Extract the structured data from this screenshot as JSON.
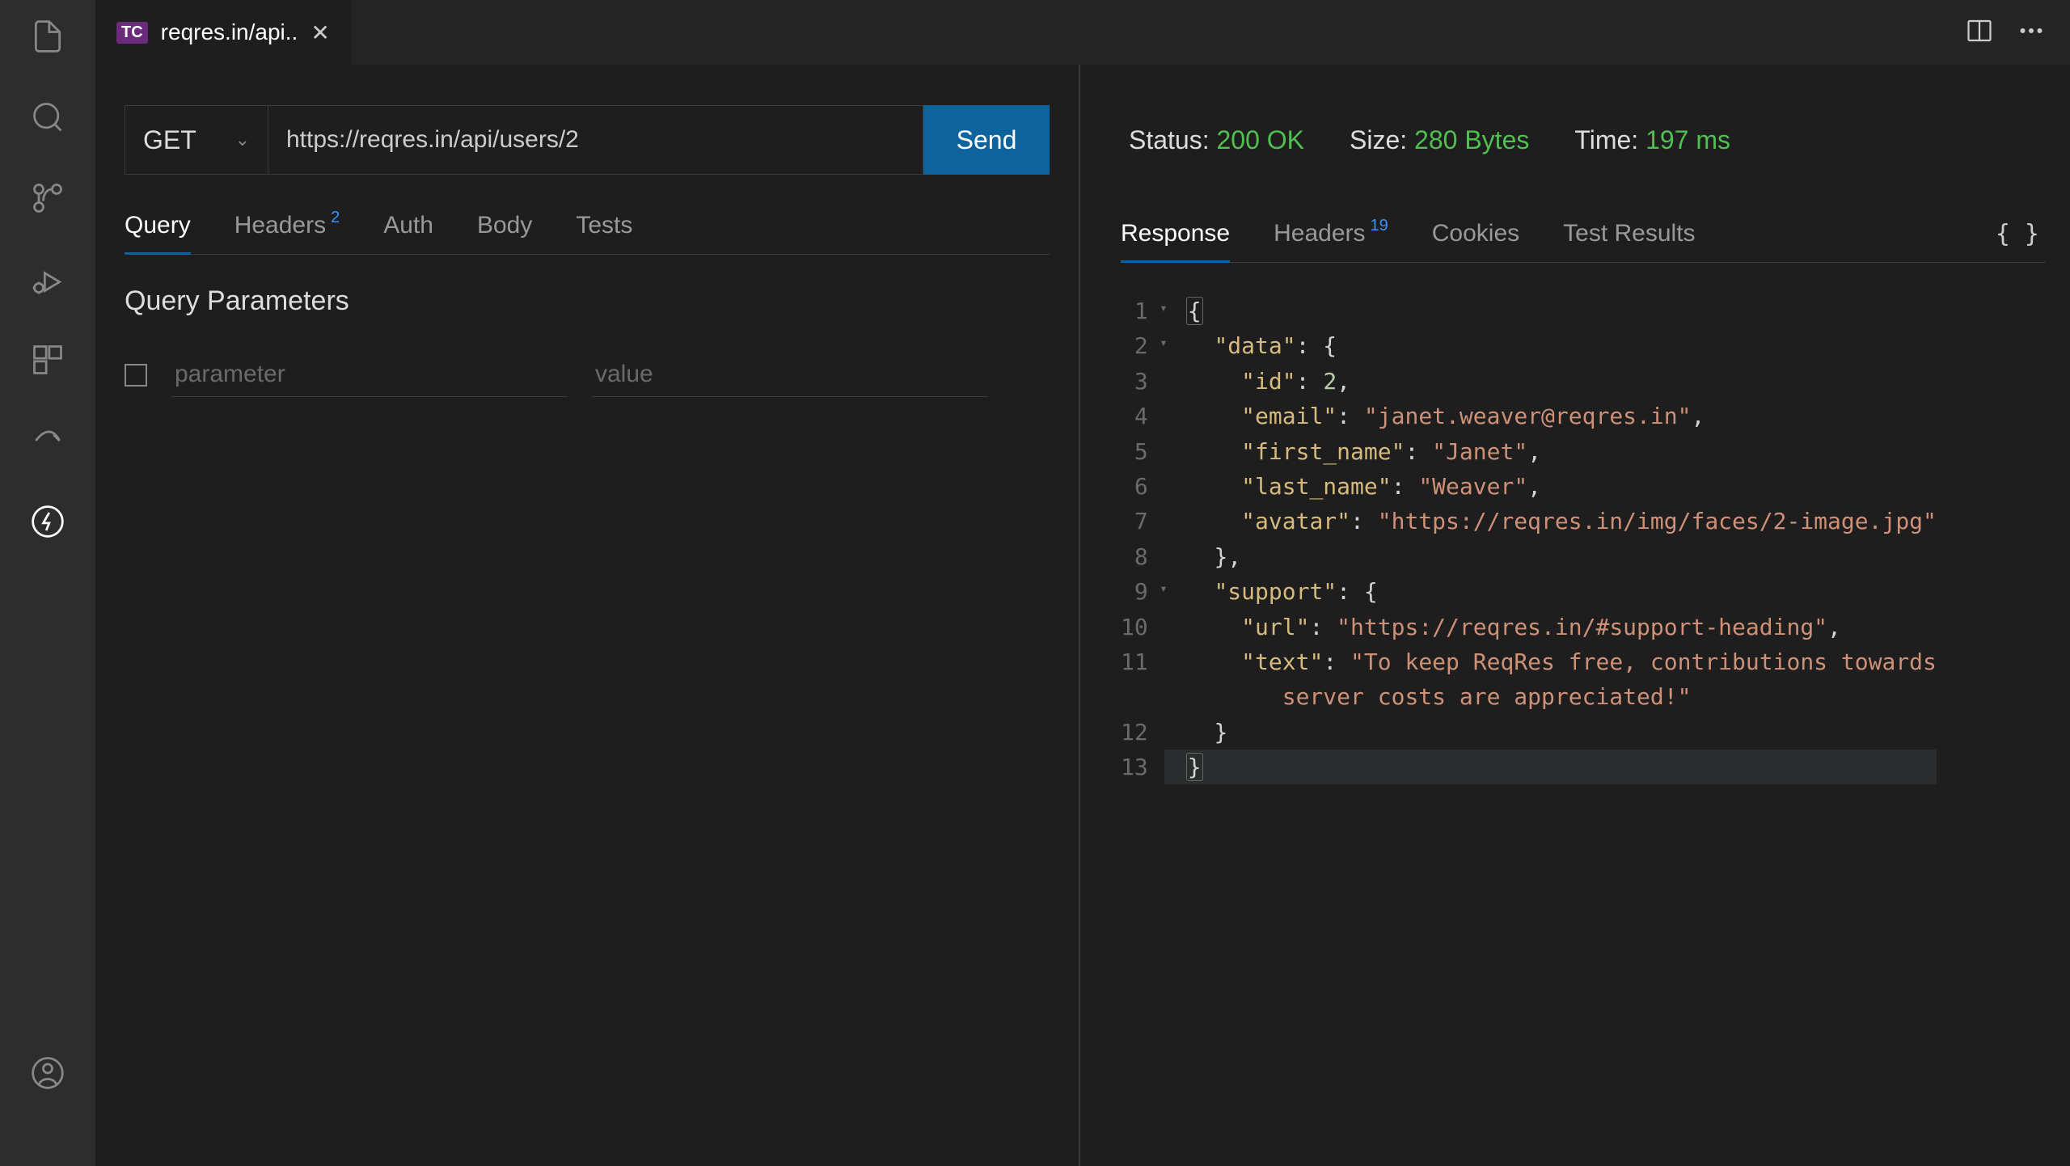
{
  "tab": {
    "badge": "TC",
    "title": "reqres.in/api.."
  },
  "request": {
    "method": "GET",
    "url": "https://reqres.in/api/users/2",
    "send_label": "Send"
  },
  "req_tabs": {
    "query": "Query",
    "headers": "Headers",
    "headers_badge": "2",
    "auth": "Auth",
    "body": "Body",
    "tests": "Tests"
  },
  "query_section": {
    "heading": "Query Parameters",
    "param_placeholder": "parameter",
    "value_placeholder": "value"
  },
  "response_stats": {
    "status_label": "Status: ",
    "status_value": "200 OK",
    "size_label": "Size: ",
    "size_value": "280 Bytes",
    "time_label": "Time: ",
    "time_value": "197 ms"
  },
  "res_tabs": {
    "response": "Response",
    "headers": "Headers",
    "headers_badge": "19",
    "cookies": "Cookies",
    "test_results": "Test Results",
    "format": "{ }"
  },
  "json": {
    "data": {
      "id": 2,
      "email": "janet.weaver@reqres.in",
      "first_name": "Janet",
      "last_name": "Weaver",
      "avatar": "https://reqres.in/img/faces/2-image.jpg"
    },
    "support": {
      "url": "https://reqres.in/#support-heading",
      "text": "To keep ReqRes free, contributions towards server costs are appreciated!"
    }
  }
}
